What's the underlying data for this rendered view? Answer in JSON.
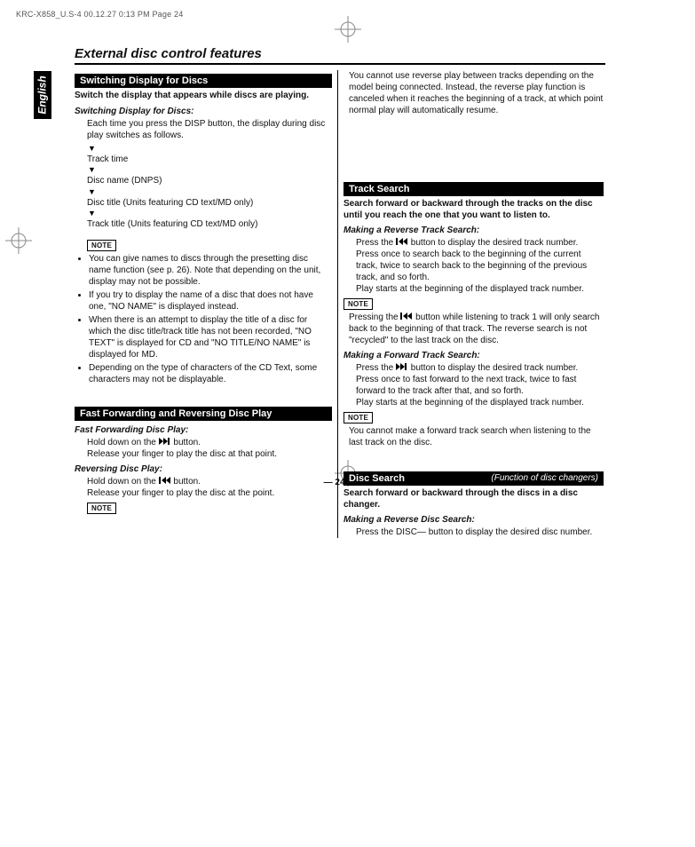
{
  "print": {
    "header": "KRC-X858_U.S-4  00.12.27 0:13 PM  Page 24",
    "page_marker": "— 24 —"
  },
  "language_tab": "English",
  "title": "External disc control features",
  "left": {
    "sec1": {
      "heading": "Switching Display for Discs",
      "intro": "Switch the display that appears while discs are playing.",
      "sub1": "Switching Display for Discs:",
      "sub1_body": "Each time you press the DISP button, the display during disc play switches as follows.",
      "flow": {
        "a": "Track time",
        "b": "Disc name (DNPS)",
        "c": "Disc title (Units featuring CD text/MD only)",
        "d": "Track title (Units featuring CD text/MD only)"
      },
      "note_label": "NOTE",
      "bullets": {
        "b1": "You can give names to discs through the presetting disc name function  (see p. 26). Note that depending on the unit, display may not be possible.",
        "b2": "If you try to display the name of a disc that does not have one, \"NO NAME\" is displayed instead.",
        "b3": "When there is an attempt to display the title of a disc for which the disc title/track title has not been recorded, \"NO TEXT\" is displayed for CD and \"NO TITLE/NO NAME\" is displayed for MD.",
        "b4": "Depending on the type of characters of the CD Text, some characters may not be displayable."
      }
    },
    "sec2": {
      "heading": "Fast Forwarding and Reversing Disc Play",
      "sub1": "Fast Forwarding Disc Play:",
      "sub1_l1_pre": "Hold down on the ",
      "sub1_l1_post": " button.",
      "sub1_l2": "Release your finger to play the disc at that point.",
      "sub2": "Reversing Disc Play:",
      "sub2_l1_pre": "Hold down on the ",
      "sub2_l1_post": " button.",
      "sub2_l2": "Release your finger to play the disc at the point.",
      "note_label": "NOTE"
    }
  },
  "right": {
    "top_para": "You cannot use reverse play between tracks depending on the model being connected. Instead, the reverse play function is canceled when it reaches the beginning of a track, at which point normal play will automatically resume.",
    "sec3": {
      "heading": "Track Search",
      "intro": "Search forward or backward through the tracks on the disc until you reach the one that you want to listen to.",
      "sub1": "Making a Reverse Track Search:",
      "sub1_l1_pre": "Press the ",
      "sub1_l1_post": " button to display the desired track number.",
      "sub1_l2": "Press once to search back to the beginning of the current track, twice to search back to the beginning of the previous track, and so forth.",
      "sub1_l3": "Play starts at the beginning of the displayed track number.",
      "note_label": "NOTE",
      "note_body_pre": "Pressing the ",
      "note_body_post": " button while listening to track 1 will only search back to the beginning of that track. The reverse search is not \"recycled\" to the last track on the disc.",
      "sub2": "Making a Forward Track Search:",
      "sub2_l1_pre": "Press the ",
      "sub2_l1_post": " button to display the desired track number.",
      "sub2_l2": "Press once to fast forward to the next track, twice to fast forward to the track after that, and so forth.",
      "sub2_l3": "Play starts at the beginning of the displayed track number.",
      "note_label2": "NOTE",
      "note_body2": "You cannot make a forward track search when listening to the last track on the disc."
    },
    "sec4": {
      "heading": "Disc Search",
      "func": "(Function of disc changers)",
      "intro": "Search forward or backward through the discs in a disc changer.",
      "sub1": "Making a Reverse Disc Search:",
      "sub1_body": "Press the DISC— button to display the desired disc number."
    }
  }
}
